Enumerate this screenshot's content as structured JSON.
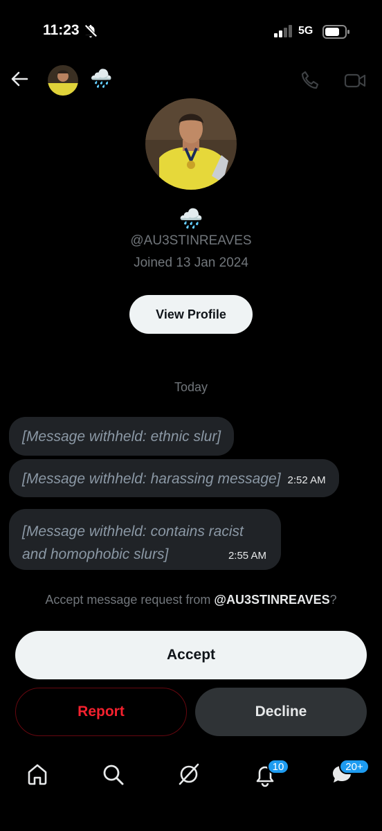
{
  "status_bar": {
    "time": "11:23",
    "network": "5G"
  },
  "header": {
    "name": "🌧️",
    "icons": [
      "back-arrow-icon",
      "phone-icon",
      "video-camera-icon"
    ]
  },
  "profile": {
    "name": "🌧️",
    "handle": "@AU3STINREAVES",
    "joined": "Joined 13 Jan 2024",
    "view_profile_label": "View Profile"
  },
  "conversation": {
    "date_divider": "Today",
    "messages": [
      {
        "text": "[Message withheld: ethnic slur]",
        "time": ""
      },
      {
        "text": "[Message withheld: harassing message]",
        "time": "2:52 AM"
      },
      {
        "text": "[Message withheld: contains racist and homophobic slurs]",
        "time": "2:55 AM"
      }
    ]
  },
  "request": {
    "prompt_prefix": "Accept message request from ",
    "handle": "@AU3STINREAVES",
    "prompt_suffix": "?",
    "accept_label": "Accept",
    "report_label": "Report",
    "decline_label": "Decline"
  },
  "nav": {
    "icons": [
      "home-icon",
      "search-icon",
      "grok-icon",
      "bell-icon",
      "messages-icon"
    ],
    "notifications_badge": "10",
    "messages_badge": "20+"
  },
  "colors": {
    "background": "#000000",
    "bubble": "#202327",
    "muted_text": "#71767b",
    "report_red": "#f4212e",
    "badge_blue": "#1d9bf0"
  }
}
